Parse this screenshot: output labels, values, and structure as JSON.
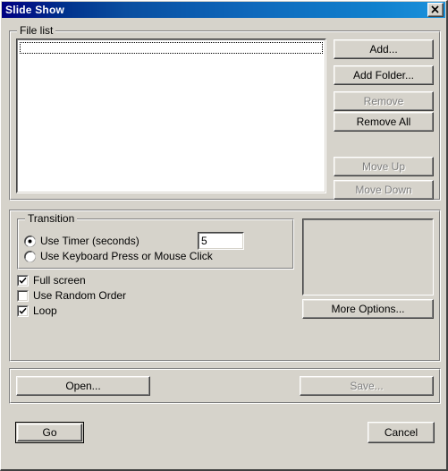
{
  "window": {
    "title": "Slide Show",
    "close_icon": "close-icon",
    "background_color": "#d6d3cb",
    "titlebar_gradient_start": "#000082",
    "titlebar_gradient_end": "#1b92dc"
  },
  "file_list_group": {
    "title": "File list",
    "listbox": {
      "items": [],
      "focused_row": true
    },
    "buttons": [
      {
        "label": "Add...",
        "enabled": true
      },
      {
        "label": "Add Folder...",
        "enabled": true
      },
      {
        "label": "Remove",
        "enabled": false
      },
      {
        "label": "Remove All",
        "enabled": true
      },
      {
        "label": "Move Up",
        "enabled": false
      },
      {
        "label": "Move Down",
        "enabled": false
      }
    ]
  },
  "options_group": {
    "transition": {
      "title": "Transition",
      "radios": [
        {
          "label": "Use Timer (seconds)",
          "selected": true
        },
        {
          "label": "Use Keyboard Press or Mouse Click",
          "selected": false
        }
      ],
      "timer_value": "5",
      "timer_placeholder": ""
    },
    "checkboxes": [
      {
        "label": "Full screen",
        "checked": true
      },
      {
        "label": "Use Random Order",
        "checked": false
      },
      {
        "label": "Loop",
        "checked": true
      }
    ],
    "preview_panel": {
      "content": ""
    },
    "more_options_label": "More Options..."
  },
  "file_ops_group": {
    "open_label": "Open...",
    "open_enabled": true,
    "save_label": "Save...",
    "save_enabled": false
  },
  "footer": {
    "go_label": "Go",
    "go_default": true,
    "cancel_label": "Cancel"
  }
}
